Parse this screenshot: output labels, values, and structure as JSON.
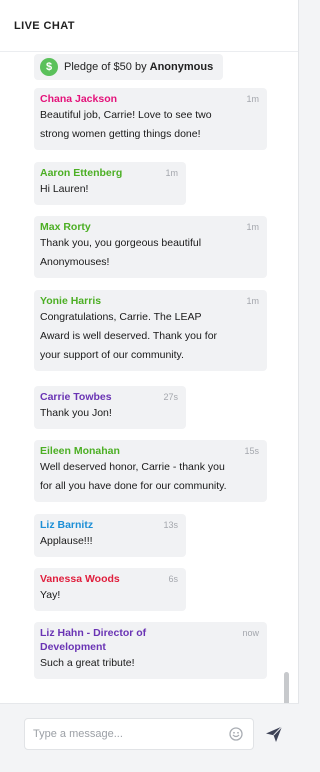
{
  "header": {
    "title": "LIVE CHAT"
  },
  "pledge": {
    "icon": "dollar-icon",
    "prefix": "Pledge of $50 by ",
    "donor": "Anonymous"
  },
  "colors": {
    "pink": "#e4127a",
    "green": "#4caf24",
    "purple": "#6a34b4",
    "blue": "#1c8fd6",
    "red": "#e01f3d",
    "bubble": "#f1f2f4"
  },
  "messages": [
    {
      "name": "Chana Jackson",
      "time": "1m",
      "lines": [
        "Beautiful job, Carrie! Love to see two",
        "strong women getting things done!"
      ]
    },
    {
      "name": "Aaron Ettenberg",
      "time": "1m",
      "lines": [
        "Hi Lauren!"
      ]
    },
    {
      "name": "Max Rorty",
      "time": "1m",
      "lines": [
        "Thank you, you gorgeous beautiful",
        "Anonymouses!"
      ]
    },
    {
      "name": "Yonie Harris",
      "time": "1m",
      "lines": [
        "Congratulations, Carrie. The LEAP",
        "Award is well deserved. Thank you for",
        "your support of our community."
      ]
    },
    {
      "name": "Carrie Towbes",
      "time": "27s",
      "lines": [
        "Thank you Jon!"
      ]
    },
    {
      "name": "Eileen Monahan",
      "time": "15s",
      "lines": [
        "Well deserved honor, Carrie - thank you",
        "for all you have done for our community."
      ]
    },
    {
      "name": "Liz Barnitz",
      "time": "13s",
      "lines": [
        "Applause!!!"
      ]
    },
    {
      "name": "Vanessa Woods",
      "time": "6s",
      "lines": [
        "Yay!"
      ]
    },
    {
      "name": "Liz Hahn - Director of Development",
      "time": "now",
      "lines": [
        "Such a great tribute!"
      ]
    }
  ],
  "composer": {
    "placeholder": "Type a message...",
    "emoji_icon": "smiley-icon",
    "send_icon": "send-icon"
  }
}
